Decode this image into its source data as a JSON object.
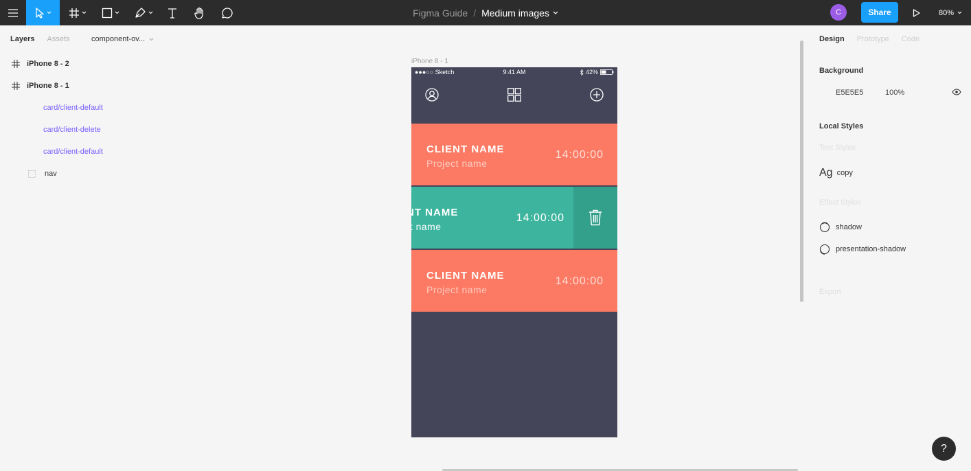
{
  "toolbar": {
    "project": "Figma Guide",
    "separator": "/",
    "file_name": "Medium images",
    "avatar_initial": "C",
    "share_label": "Share",
    "zoom": "80%",
    "accent": "#18a0fb"
  },
  "left_panel": {
    "tabs": [
      "Layers",
      "Assets"
    ],
    "page": "component-ov...",
    "layers": [
      {
        "label": "iPhone 8 - 2",
        "kind": "frame"
      },
      {
        "label": "iPhone 8 - 1",
        "kind": "frame"
      },
      {
        "label": "card/client-default",
        "kind": "component"
      },
      {
        "label": "card/client-delete",
        "kind": "component"
      },
      {
        "label": "card/client-default",
        "kind": "component"
      },
      {
        "label": "nav",
        "kind": "group"
      }
    ]
  },
  "canvas": {
    "frame_label": "iPhone 8 - 1",
    "status": {
      "carrier": "●●●○○ Sketch",
      "time": "9:41 AM",
      "battery": "42%"
    },
    "cards": [
      {
        "name": "CLIENT NAME",
        "project": "Project name",
        "time": "14:00:00",
        "variant": "default",
        "color": "#fc7a63"
      },
      {
        "name": "ENT NAME",
        "project": "ect name",
        "time": "14:00:00",
        "variant": "delete",
        "color": "#3db49e"
      },
      {
        "name": "CLIENT NAME",
        "project": "Project name",
        "time": "14:00:00",
        "variant": "default",
        "color": "#fc7a63"
      }
    ],
    "phone_bg": "#454559"
  },
  "right_panel": {
    "tabs": [
      "Design",
      "Prototype",
      "Code"
    ],
    "background_heading": "Background",
    "bg_hex": "E5E5E5",
    "bg_opacity": "100%",
    "local_styles_heading": "Local Styles",
    "text_styles_heading": "Text Styles",
    "text_style": {
      "sample": "Ag",
      "name": "copy"
    },
    "effect_styles_heading": "Effect Styles",
    "effect_styles": [
      "shadow",
      "presentation-shadow"
    ],
    "export_heading": "Export"
  },
  "help_label": "?"
}
